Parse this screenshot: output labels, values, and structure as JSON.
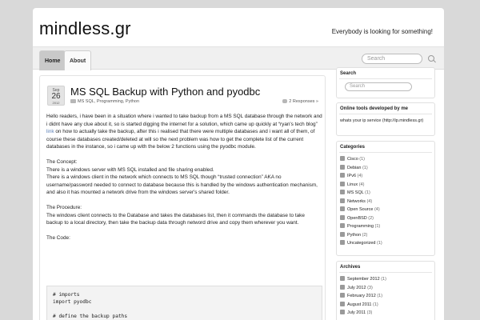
{
  "site": {
    "title": "mindless.gr",
    "tagline": "Everybody is looking for something!"
  },
  "nav": {
    "tabs": [
      {
        "label": "Home",
        "active": true
      },
      {
        "label": "About",
        "active": false
      }
    ],
    "search_placeholder": "Search"
  },
  "post": {
    "date": {
      "month": "Sep",
      "day": "26",
      "year": "2012"
    },
    "title": "MS SQL Backup with Python and pyodbc",
    "categories": "MS SQL, Programming, Python",
    "responses": "2 Responses »",
    "p1_before_link": "Hello readers, i have been in a situation where i wanted to take backup from a MS SQL database through the network and i didnt have any clue about it, so is started digging the internet for a solution, which came up quickly at “ryan's tech blog”",
    "p1_link": "link",
    "p1_after_link": "on how to actually take the backup, after this i realised that there were multiple databases and i want all of them, of course these databases created/deleted at will so the next problem was how to get the complete list of the current databases in the instance, so i came up with the below 2 functions using the pyodbc module.",
    "concept_heading": "The Concept:",
    "concept_line1": "There is a windows server with MS SQL installed and file sharing enabled.",
    "concept_line2": "There is a windows client in the network which connects to MS SQL though “trusted connection” AKA no username/password needed to connect to database because this is handled by the windows authentication mechanism, and also it has mounted a network drive from the windows server's shared folder.",
    "procedure_heading": "The Procedure:",
    "procedure_text": "The windows client connects to the Database and takes the databases list, then it commands the database to take backup to a local directory, then take the backup data through netword drive and copy them wherever you want.",
    "code_heading": "The Code:",
    "code": "# imports\nimport pyodbc\n\n# define the backup paths\nserver_backup_path = 'c:\\\\mssql_backup\\\\'"
  },
  "sidebar": {
    "search": {
      "title": "Search",
      "placeholder": "Search"
    },
    "tools": {
      "title": "Online tools developed by me",
      "text": "whats your ip service (http://ip.mindless.gr)"
    },
    "categories": {
      "title": "Categories",
      "items": [
        {
          "name": "Cisco",
          "count": "(1)"
        },
        {
          "name": "Debian",
          "count": "(1)"
        },
        {
          "name": "IPv6",
          "count": "(4)"
        },
        {
          "name": "Linux",
          "count": "(4)"
        },
        {
          "name": "MS SQL",
          "count": "(1)"
        },
        {
          "name": "Networks",
          "count": "(4)"
        },
        {
          "name": "Open Source",
          "count": "(4)"
        },
        {
          "name": "OpenBSD",
          "count": "(2)"
        },
        {
          "name": "Programming",
          "count": "(1)"
        },
        {
          "name": "Python",
          "count": "(2)"
        },
        {
          "name": "Uncategorized",
          "count": "(1)"
        }
      ]
    },
    "archives": {
      "title": "Archives",
      "items": [
        {
          "name": "September 2012",
          "count": "(1)"
        },
        {
          "name": "July 2012",
          "count": "(3)"
        },
        {
          "name": "February 2012",
          "count": "(1)"
        },
        {
          "name": "August 2011",
          "count": "(1)"
        },
        {
          "name": "July 2011",
          "count": "(3)"
        }
      ]
    }
  }
}
